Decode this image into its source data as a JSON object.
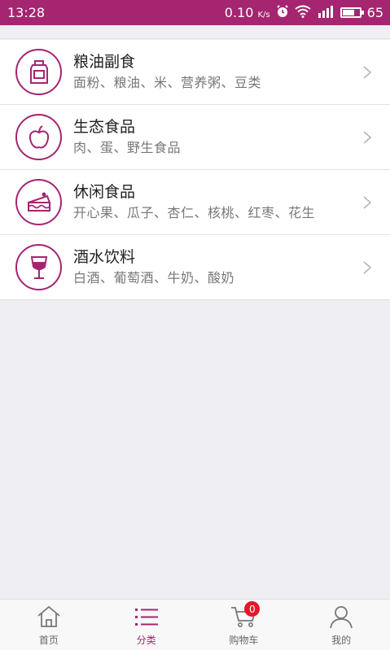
{
  "status_bar": {
    "time": "13:28",
    "network_speed": "0.10",
    "network_unit": "K/s",
    "battery": "65",
    "icons": [
      "alarm-icon",
      "wifi-icon",
      "signal-icon",
      "battery-icon"
    ]
  },
  "categories": [
    {
      "title": "粮油副食",
      "subtitle": "面粉、粮油、米、营养粥、豆类",
      "icon": "oil-bottle-icon"
    },
    {
      "title": "生态食品",
      "subtitle": "肉、蛋、野生食品",
      "icon": "apple-icon"
    },
    {
      "title": "休闲食品",
      "subtitle": "开心果、瓜子、杏仁、核桃、红枣、花生",
      "icon": "cake-icon"
    },
    {
      "title": "酒水饮料",
      "subtitle": "白酒、葡萄酒、牛奶、酸奶",
      "icon": "wine-glass-icon"
    }
  ],
  "bottom_nav": {
    "items": [
      {
        "label": "首页",
        "icon": "home-icon",
        "active": false
      },
      {
        "label": "分类",
        "icon": "list-icon",
        "active": true
      },
      {
        "label": "购物车",
        "icon": "cart-icon",
        "active": false,
        "badge": "0"
      },
      {
        "label": "我的",
        "icon": "user-icon",
        "active": false
      }
    ]
  },
  "colors": {
    "accent": "#a52570",
    "badge": "#e8162a",
    "background": "#eeeef3"
  }
}
